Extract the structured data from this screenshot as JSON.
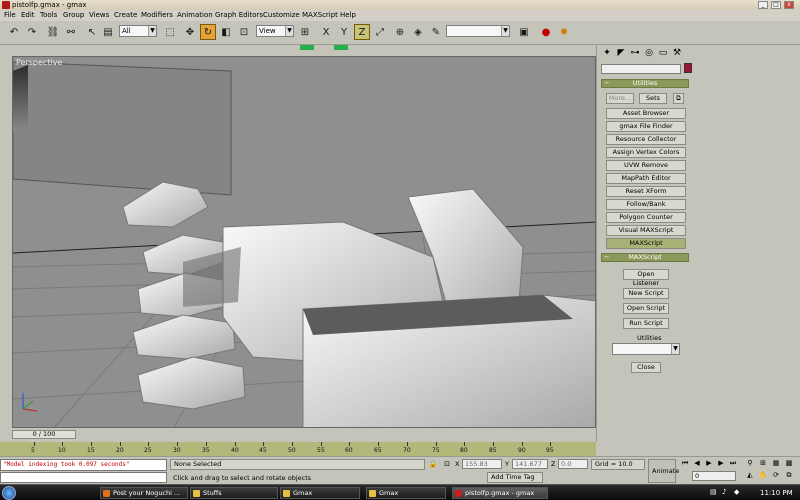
{
  "window": {
    "title": "pistolfp.gmax - gmax"
  },
  "menu": [
    "File",
    "Edit",
    "Tools",
    "Group",
    "Views",
    "Create",
    "Modifiers",
    "Animation",
    "Graph Editors",
    "Customize",
    "MAXScript",
    "Help"
  ],
  "toolbar": {
    "selection_filter": "All",
    "coord_system": "View",
    "named_selection": ""
  },
  "viewport": {
    "label": "Perspective"
  },
  "command_panel": {
    "utilities_header": "Utilities",
    "more_label": "More...",
    "sets_label": "Sets",
    "utility_buttons": [
      "Asset Browser",
      "gmax File Finder",
      "Resource Collector",
      "Assign Vertex Colors",
      "UVW Remove",
      "MapPath Editor",
      "Reset XForm",
      "Follow/Bank",
      "Polygon Counter",
      "Visual MAXScript",
      "MAXScript"
    ],
    "active_utility": "MAXScript",
    "maxscript_header": "MAXScript",
    "open_listener": "Open Listener",
    "new_script": "New Script",
    "open_script": "Open Script",
    "run_script": "Run Script",
    "utilities_label": "Utilities",
    "utilities_dropdown": "",
    "close_label": "Close"
  },
  "timeline": {
    "slider_label": "0 / 100",
    "ticks": [
      "5",
      "10",
      "15",
      "20",
      "25",
      "30",
      "35",
      "40",
      "45",
      "50",
      "55",
      "60",
      "65",
      "70",
      "75",
      "80",
      "85",
      "90",
      "95"
    ]
  },
  "status": {
    "listener_output": "\"Model indexing took 0.097 seconds\"",
    "selection": "None Selected",
    "prompt": "Click and drag to select and rotate objects",
    "x_label": "X",
    "x_value": "155.83",
    "y_label": "Y",
    "y_value": "141.677",
    "z_label": "Z",
    "z_value": "0.0",
    "grid": "Grid = 10.0",
    "add_time_tag": "Add Time Tag",
    "animate": "Animate",
    "frame": "0"
  },
  "taskbar": {
    "items": [
      "Post your Noguchi ...",
      "Stuffs",
      "Gmax",
      "Gmax",
      "pistolfp.gmax - gmax"
    ],
    "active_item": "pistolfp.gmax - gmax",
    "clock": "11:10 PM"
  },
  "colors": {
    "panel": "#c5c4ba",
    "rollout": "#8b9a5a",
    "active_button": "#a8b276",
    "viewport_bg": "#8f8f8f",
    "trackbar": "#b3b77a"
  }
}
